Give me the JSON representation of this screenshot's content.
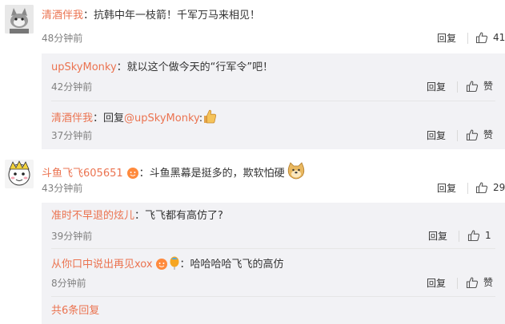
{
  "comments": [
    {
      "user": "清酒伴我",
      "text": "：抗韩中年一枝箭！千军万马来相见！",
      "time": "48分钟前",
      "reply_label": "回复",
      "likes": "41",
      "replies": [
        {
          "user": "upSkyMonky",
          "text": "：就以这个做今天的“行军令”吧！",
          "time": "42分钟前",
          "reply_label": "回复",
          "like_label": "赞"
        },
        {
          "user": "清酒伴我",
          "text_prefix": "：回复",
          "mention": "@upSkyMonky",
          "text_suffix": ":",
          "emoji": "thumbs-up",
          "time": "37分钟前",
          "reply_label": "回复",
          "like_label": "赞"
        }
      ]
    },
    {
      "user": "斗鱼飞飞605651",
      "text": "：斗鱼黑幕是挺多的，欺软怕硬",
      "emoji": "doge",
      "time": "43分钟前",
      "reply_label": "回复",
      "likes": "29",
      "replies": [
        {
          "user": "准时不早退的炫儿",
          "text": "：飞飞都有高仿了?",
          "time": "39分钟前",
          "reply_label": "回复",
          "likes": "1"
        },
        {
          "user": "从你口中说出再见xox",
          "text": "：哈哈哈哈飞飞的高仿",
          "time": "8分钟前",
          "reply_label": "回复",
          "like_label": "赞"
        }
      ],
      "more_replies": "共6条回复"
    }
  ],
  "colors": {
    "username": "#eb7350",
    "reply_bg": "#f2f2f5",
    "time": "#808080"
  }
}
